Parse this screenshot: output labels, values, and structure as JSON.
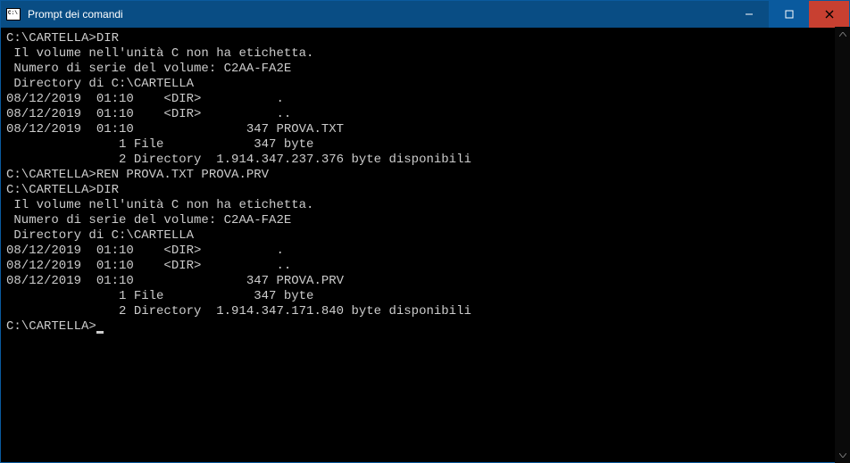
{
  "titlebar": {
    "title": "Prompt dei comandi"
  },
  "terminal": {
    "lines": [
      "",
      "C:\\CARTELLA>DIR",
      " Il volume nell'unità C non ha etichetta.",
      " Numero di serie del volume: C2AA-FA2E",
      "",
      " Directory di C:\\CARTELLA",
      "",
      "08/12/2019  01:10    <DIR>          .",
      "08/12/2019  01:10    <DIR>          ..",
      "08/12/2019  01:10               347 PROVA.TXT",
      "               1 File            347 byte",
      "               2 Directory  1.914.347.237.376 byte disponibili",
      "",
      "C:\\CARTELLA>REN PROVA.TXT PROVA.PRV",
      "",
      "C:\\CARTELLA>DIR",
      " Il volume nell'unità C non ha etichetta.",
      " Numero di serie del volume: C2AA-FA2E",
      "",
      " Directory di C:\\CARTELLA",
      "",
      "08/12/2019  01:10    <DIR>          .",
      "08/12/2019  01:10    <DIR>          ..",
      "08/12/2019  01:10               347 PROVA.PRV",
      "               1 File            347 byte",
      "               2 Directory  1.914.347.171.840 byte disponibili",
      "",
      "C:\\CARTELLA>"
    ]
  }
}
